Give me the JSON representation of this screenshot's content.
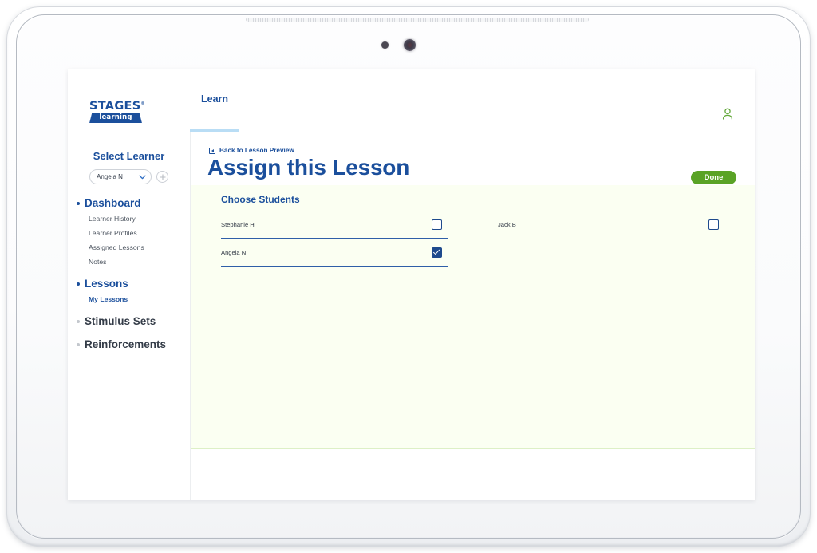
{
  "device": {
    "type": "tablet",
    "sensor_icon": "proximity-sensor",
    "camera_icon": "front-camera"
  },
  "topbar": {
    "logo": {
      "word": "STAGES",
      "trademark": "®",
      "plate": "learning"
    },
    "tabs": [
      {
        "label": "Learn",
        "active": true
      }
    ],
    "account_icon": "account-person-icon"
  },
  "sidebar": {
    "select_learner_title": "Select Learner",
    "learner_select": {
      "value": "Angela N",
      "chevron_icon": "chevron-down-icon"
    },
    "add_learner_icon": "plus-icon",
    "nav": [
      {
        "label": "Dashboard",
        "state": "active",
        "children": [
          {
            "label": "Learner History",
            "highlight": false
          },
          {
            "label": "Learner Profiles",
            "highlight": false
          },
          {
            "label": "Assigned Lessons",
            "highlight": false
          },
          {
            "label": "Notes",
            "highlight": false
          }
        ]
      },
      {
        "label": "Lessons",
        "state": "active",
        "children": [
          {
            "label": "My Lessons",
            "highlight": true
          }
        ]
      },
      {
        "label": "Stimulus Sets",
        "state": "idle",
        "children": []
      },
      {
        "label": "Reinforcements",
        "state": "idle",
        "children": []
      }
    ]
  },
  "content": {
    "back_link": {
      "label": "Back to Lesson Preview",
      "icon": "back-arrow-box-icon"
    },
    "title": "Assign this Lesson",
    "done_label": "Done",
    "panel": {
      "heading": "Choose Students",
      "columns": [
        {
          "students": [
            {
              "name": "Stephanie H",
              "checked": false
            },
            {
              "name": "Angela N",
              "checked": true
            }
          ]
        },
        {
          "students": [
            {
              "name": "Jack B",
              "checked": false
            }
          ]
        }
      ]
    }
  },
  "colors": {
    "brand_blue": "#1b4f9c",
    "accent_green": "#5aa326",
    "panel_bg": "#fbfff2",
    "row_line": "#2f5fa8",
    "checkbox": "#1e4a8c",
    "tab_underline": "#b9ddf5"
  }
}
